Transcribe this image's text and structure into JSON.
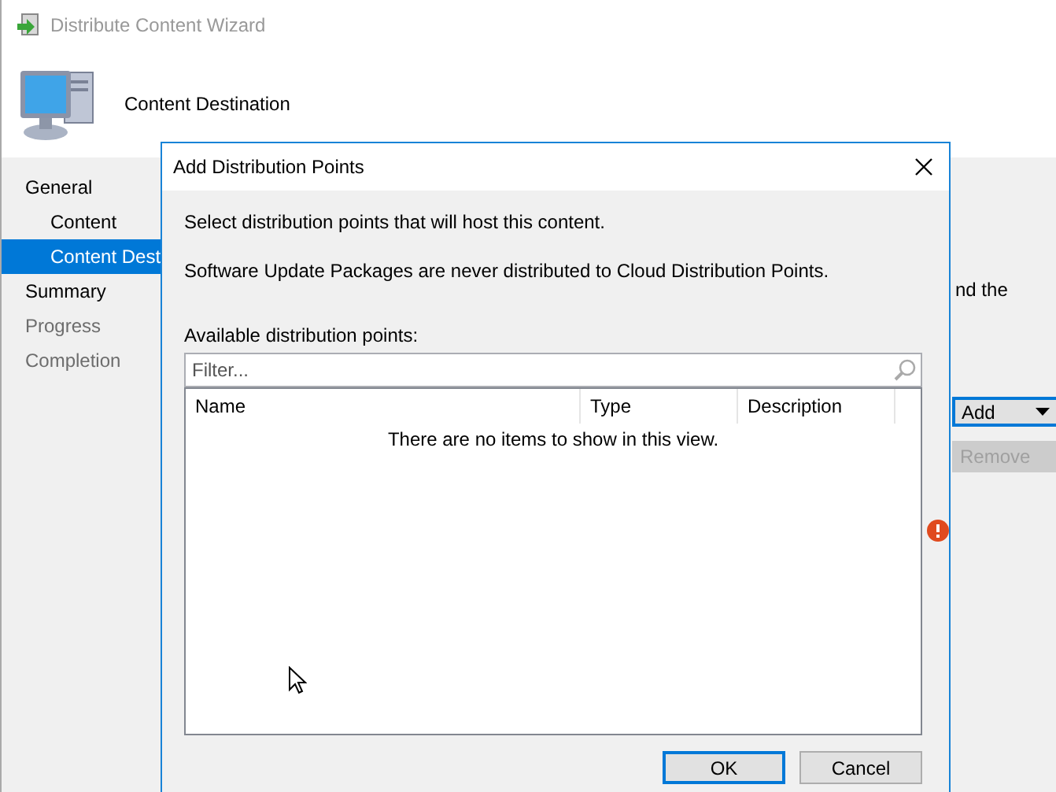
{
  "window": {
    "title": "Distribute Content Wizard"
  },
  "header": {
    "title": "Content Destination"
  },
  "nav": [
    {
      "label": "General",
      "sub": false,
      "selected": false,
      "disabled": false
    },
    {
      "label": "Content",
      "sub": true,
      "selected": false,
      "disabled": false
    },
    {
      "label": "Content Dest",
      "sub": true,
      "selected": true,
      "disabled": false
    },
    {
      "label": "Summary",
      "sub": false,
      "selected": false,
      "disabled": false
    },
    {
      "label": "Progress",
      "sub": false,
      "selected": false,
      "disabled": true
    },
    {
      "label": "Completion",
      "sub": false,
      "selected": false,
      "disabled": true
    }
  ],
  "page": {
    "text_fragment": "nd the",
    "add_button": {
      "label": "Add",
      "focused": true
    },
    "remove_button": {
      "label": "Remove",
      "disabled": true
    }
  },
  "dialog": {
    "title": "Add Distribution Points",
    "intro": "Select distribution points that will host this content.",
    "note": "Software Update Packages are never distributed to Cloud Distribution Points.",
    "list_label": "Available distribution points:",
    "filter": {
      "placeholder": "Filter..."
    },
    "columns": [
      "Name",
      "Type",
      "Description"
    ],
    "empty_message": "There are no items to show in this view.",
    "buttons": [
      {
        "label": "OK",
        "focused": true
      },
      {
        "label": "Cancel",
        "focused": false
      }
    ]
  }
}
